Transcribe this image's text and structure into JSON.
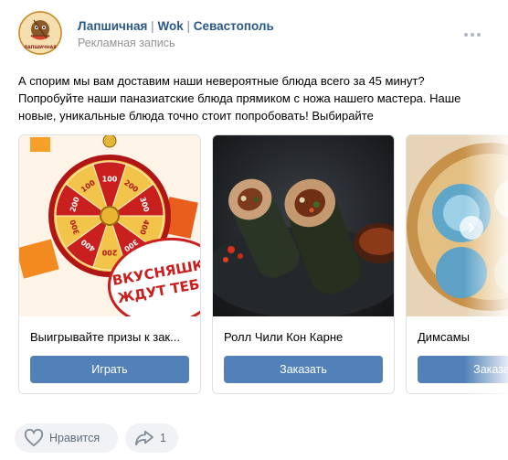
{
  "post": {
    "author_name": "Лапшичная",
    "author_sep1": "|",
    "author_part2": "Wok",
    "author_sep2": "|",
    "author_part3": "Севастополь",
    "subtitle": "Рекламная запись",
    "avatar_logo_text": "ЛАПШИЧНАЯ",
    "text_lines": [
      "А спорим мы вам доставим наши невероятные блюда всего за 45 минут?",
      "Попробуйте наши паназиатские блюда прямиком с ножа нашего мастера. Наше",
      "новые, уникальные блюда точно стоит попробовать! Выбирайте"
    ]
  },
  "cards": [
    {
      "title": "Выигрывайте призы к зак...",
      "button": "Играть",
      "wheel_numbers": [
        "100",
        "200",
        "300",
        "400",
        "300",
        "200",
        "400",
        "300",
        "200",
        "100"
      ],
      "banner_line1": "ВКУСНЯШКИ",
      "banner_line2": "ЖДУТ ТЕБЯ!"
    },
    {
      "title": "Ролл Чили Кон Карне",
      "button": "Заказать"
    },
    {
      "title": "Димсамы",
      "button": "Заказать"
    }
  ],
  "actions": {
    "like_label": "Нравится",
    "share_count": "1"
  },
  "colors": {
    "link": "#2a5885",
    "button": "#5181b8",
    "action_bg": "#f0f2f5",
    "wheel_red": "#c9201f",
    "wheel_gold": "#f2c54a"
  }
}
